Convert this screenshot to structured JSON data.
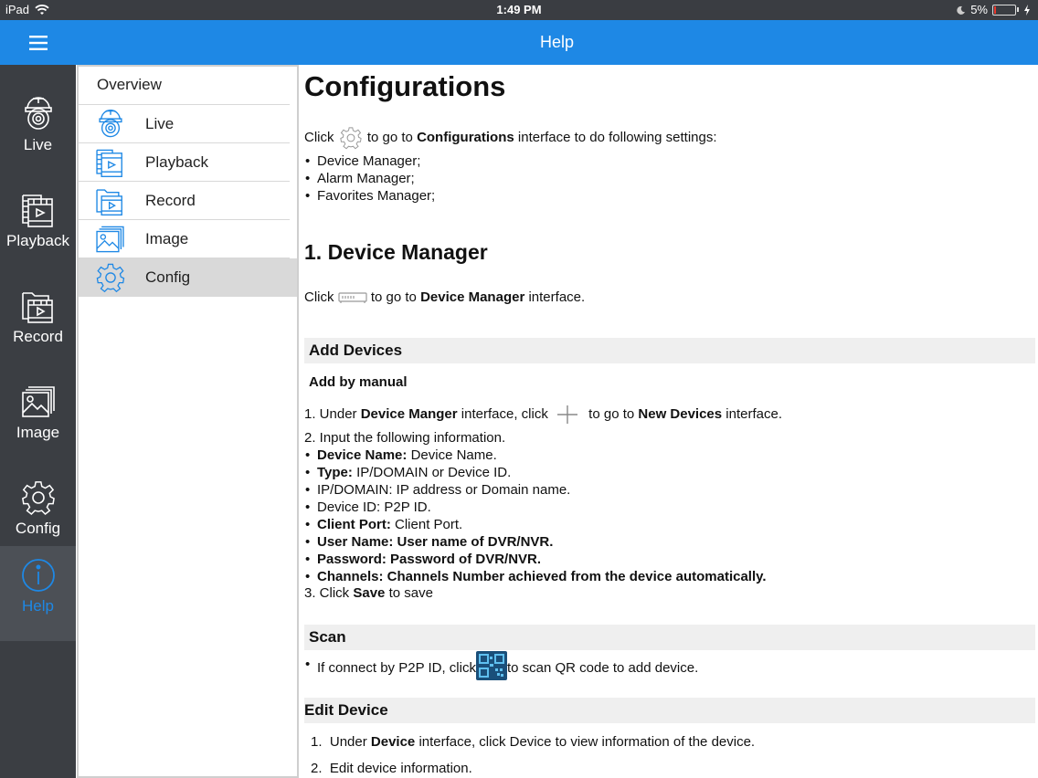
{
  "status_bar": {
    "device": "iPad",
    "time": "1:49 PM",
    "battery": "5%",
    "battery_fraction": 0.05,
    "battery_color": "#e8372d"
  },
  "colors": {
    "accent": "#1e88e5",
    "nav_bg": "#3b3e43",
    "selected_row": "#d9d9d9"
  },
  "nav": {
    "items": [
      {
        "label": "Live",
        "icon": "camera-icon"
      },
      {
        "label": "Playback",
        "icon": "playback-icon"
      },
      {
        "label": "Record",
        "icon": "record-folder-icon"
      },
      {
        "label": "Image",
        "icon": "image-icon"
      },
      {
        "label": "Config",
        "icon": "gear-icon"
      },
      {
        "label": "Help",
        "icon": "info-icon"
      }
    ],
    "active": "Help"
  },
  "header": {
    "title": "Help"
  },
  "help_index": {
    "overview": "Overview",
    "items": [
      {
        "label": "Live",
        "icon": "camera-icon"
      },
      {
        "label": "Playback",
        "icon": "playback-icon"
      },
      {
        "label": "Record",
        "icon": "record-folder-icon"
      },
      {
        "label": "Image",
        "icon": "image-icon"
      },
      {
        "label": "Config",
        "icon": "gear-icon"
      }
    ],
    "selected": "Config"
  },
  "content": {
    "title": "Configurations",
    "intro": {
      "pre": "Click",
      "mid": "to go to",
      "bold": "Configurations",
      "post": "interface to do following settings:"
    },
    "intro_list": [
      "Device Manager;",
      "Alarm Manager;",
      "Favorites Manager;"
    ],
    "section1_title": "1. Device Manager",
    "dm_line": {
      "pre": "Click",
      "mid": "to go to",
      "bold": "Device Manager",
      "post": "interface."
    },
    "add_devices": "Add Devices",
    "add_by_manual": "Add by manual",
    "step1": {
      "pre": "1. Under",
      "bold1": "Device Manger",
      "mid": "interface, click",
      "post": "to go to",
      "bold2": "New Devices",
      "end": "interface."
    },
    "step2": "2. Input the following information.",
    "fields": [
      {
        "bold": "Device Name:",
        "text": "Device Name."
      },
      {
        "bold": "Type:",
        "text": "IP/DOMAIN or Device ID."
      },
      {
        "bold": "",
        "text": "IP/DOMAIN: IP address or Domain name."
      },
      {
        "bold": "",
        "text": "Device ID: P2P ID."
      },
      {
        "bold": "Client Port:",
        "text": "Client Port."
      },
      {
        "bold": "User Name: User name of DVR/NVR.",
        "text": ""
      },
      {
        "bold": "Password: Password of DVR/NVR.",
        "text": ""
      },
      {
        "bold": "Channels: Channels Number achieved from the device automatically.",
        "text": ""
      }
    ],
    "step3": {
      "pre": "3. Click",
      "bold": "Save",
      "post": "to save"
    },
    "scan": "Scan",
    "scan_line": {
      "pre": "If connect by P2P ID, click",
      "post": "to scan QR code to add device."
    },
    "edit_device": "Edit Device",
    "edit_steps": [
      {
        "num": "1.",
        "pre": "Under",
        "bold": "Device",
        "post": "interface, click Device to view information of the device."
      },
      {
        "num": "2.",
        "pre": "Edit device information.",
        "bold": "",
        "post": ""
      }
    ]
  }
}
